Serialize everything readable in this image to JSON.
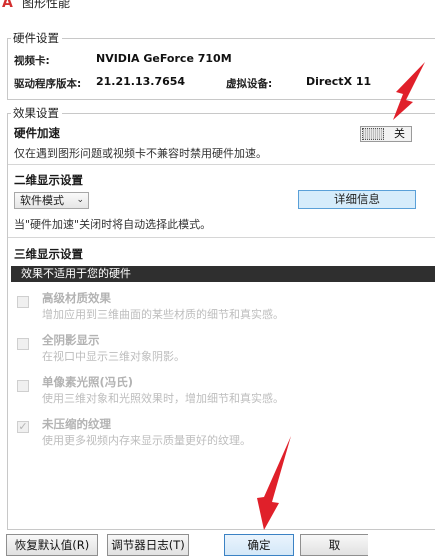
{
  "window": {
    "title": "图形性能"
  },
  "hardware_settings": {
    "legend": "硬件设置",
    "video_card_label": "视频卡:",
    "video_card_value": "NVIDIA GeForce 710M",
    "driver_label": "驱动程序版本:",
    "driver_value": "21.21.13.7654",
    "virtual_device_label": "虚拟设备:",
    "virtual_device_value": "DirectX 11"
  },
  "effects": {
    "legend": "效果设置",
    "hw_accel_title": "硬件加速",
    "hw_accel_desc": "仅在遇到图形问题或视频卡不兼容时禁用硬件加速。",
    "toggle_label": "关",
    "toggle_state": "off"
  },
  "two_d": {
    "title": "二维显示设置",
    "mode_value": "软件模式",
    "detail_button": "详细信息",
    "note": "当\"硬件加速\"关闭时将自动选择此模式。"
  },
  "three_d": {
    "title": "三维显示设置",
    "unsupported_bar": "效果不适用于您的硬件",
    "options": [
      {
        "title": "高级材质效果",
        "desc": "增加应用到三维曲面的某些材质的细节和真实感。",
        "checked": false
      },
      {
        "title": "全阴影显示",
        "desc": "在视口中显示三维对象阴影。",
        "checked": false
      },
      {
        "title": "单像素光照(冯氏)",
        "desc": "使用三维对象和光照效果时，增加细节和真实感。",
        "checked": false
      },
      {
        "title": "未压缩的纹理",
        "desc": "使用更多视频内存来显示质量更好的纹理。",
        "checked": true
      }
    ]
  },
  "footer": {
    "restore_button": "恢复默认值(R)",
    "log_button": "调节器日志(T)",
    "ok_button": "确定",
    "partial_button": "取"
  },
  "colors": {
    "annotation_arrow": "#e0202a",
    "accent_button": "#d6ecfb",
    "unsupported_bar": "#2f2f2f"
  },
  "icons": {
    "app": "autocad-a-icon",
    "dropdown": "chevron-down-icon",
    "check": "check-icon"
  }
}
